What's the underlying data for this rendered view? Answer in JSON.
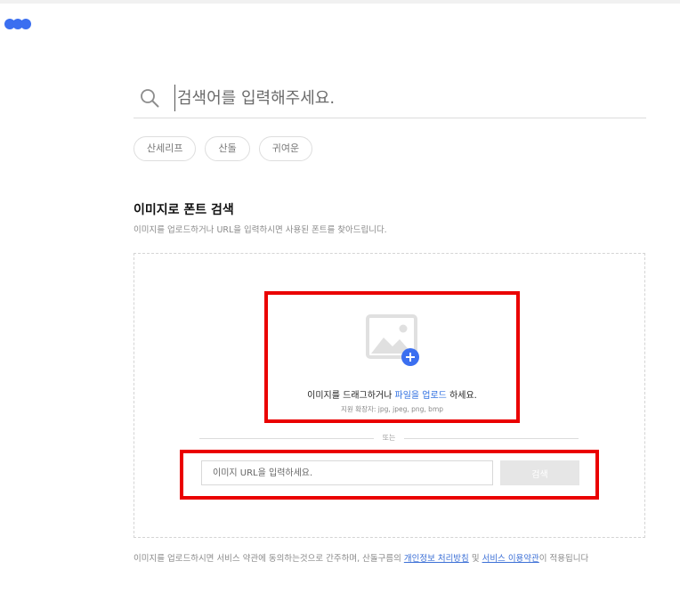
{
  "brand": {
    "logo_colors": [
      "#3b6ff0",
      "#3b6ff0",
      "#3b6ff0"
    ]
  },
  "search": {
    "placeholder": "검색어를 입력해주세요.",
    "value": ""
  },
  "tags": [
    "산세리프",
    "산돌",
    "귀여운"
  ],
  "image_search": {
    "title": "이미지로 폰트 검색",
    "description": "이미지를 업로드하거나 URL을 입력하시면 사용된 폰트를 찾아드립니다.",
    "upload": {
      "text_before": "이미지를 드래그하거나 ",
      "link_text": "파일을 업로드",
      "text_after": " 하세요.",
      "formats": "지원 확장자: jpg, jpeg, png, bmp"
    },
    "divider_label": "또는",
    "url": {
      "placeholder": "이미지 URL을 입력하세요.",
      "value": "",
      "button_label": "검색"
    }
  },
  "terms": {
    "text_before": "이미지를 업로드하시면 서비스 약관에 동의하는것으로 간주하며, 산돌구름의 ",
    "privacy_link": "개인정보 처리방침",
    "text_middle": " 및 ",
    "service_link": "서비스 이용약관",
    "text_after": "이 적용됩니다"
  },
  "colors": {
    "accent": "#3b6ff0",
    "highlight_border": "#ea0000",
    "link": "#2f6fe0"
  },
  "icons": {
    "logo": "three-dots-logo",
    "search": "search-icon",
    "image": "image-placeholder-icon",
    "add": "plus-circle-icon"
  }
}
